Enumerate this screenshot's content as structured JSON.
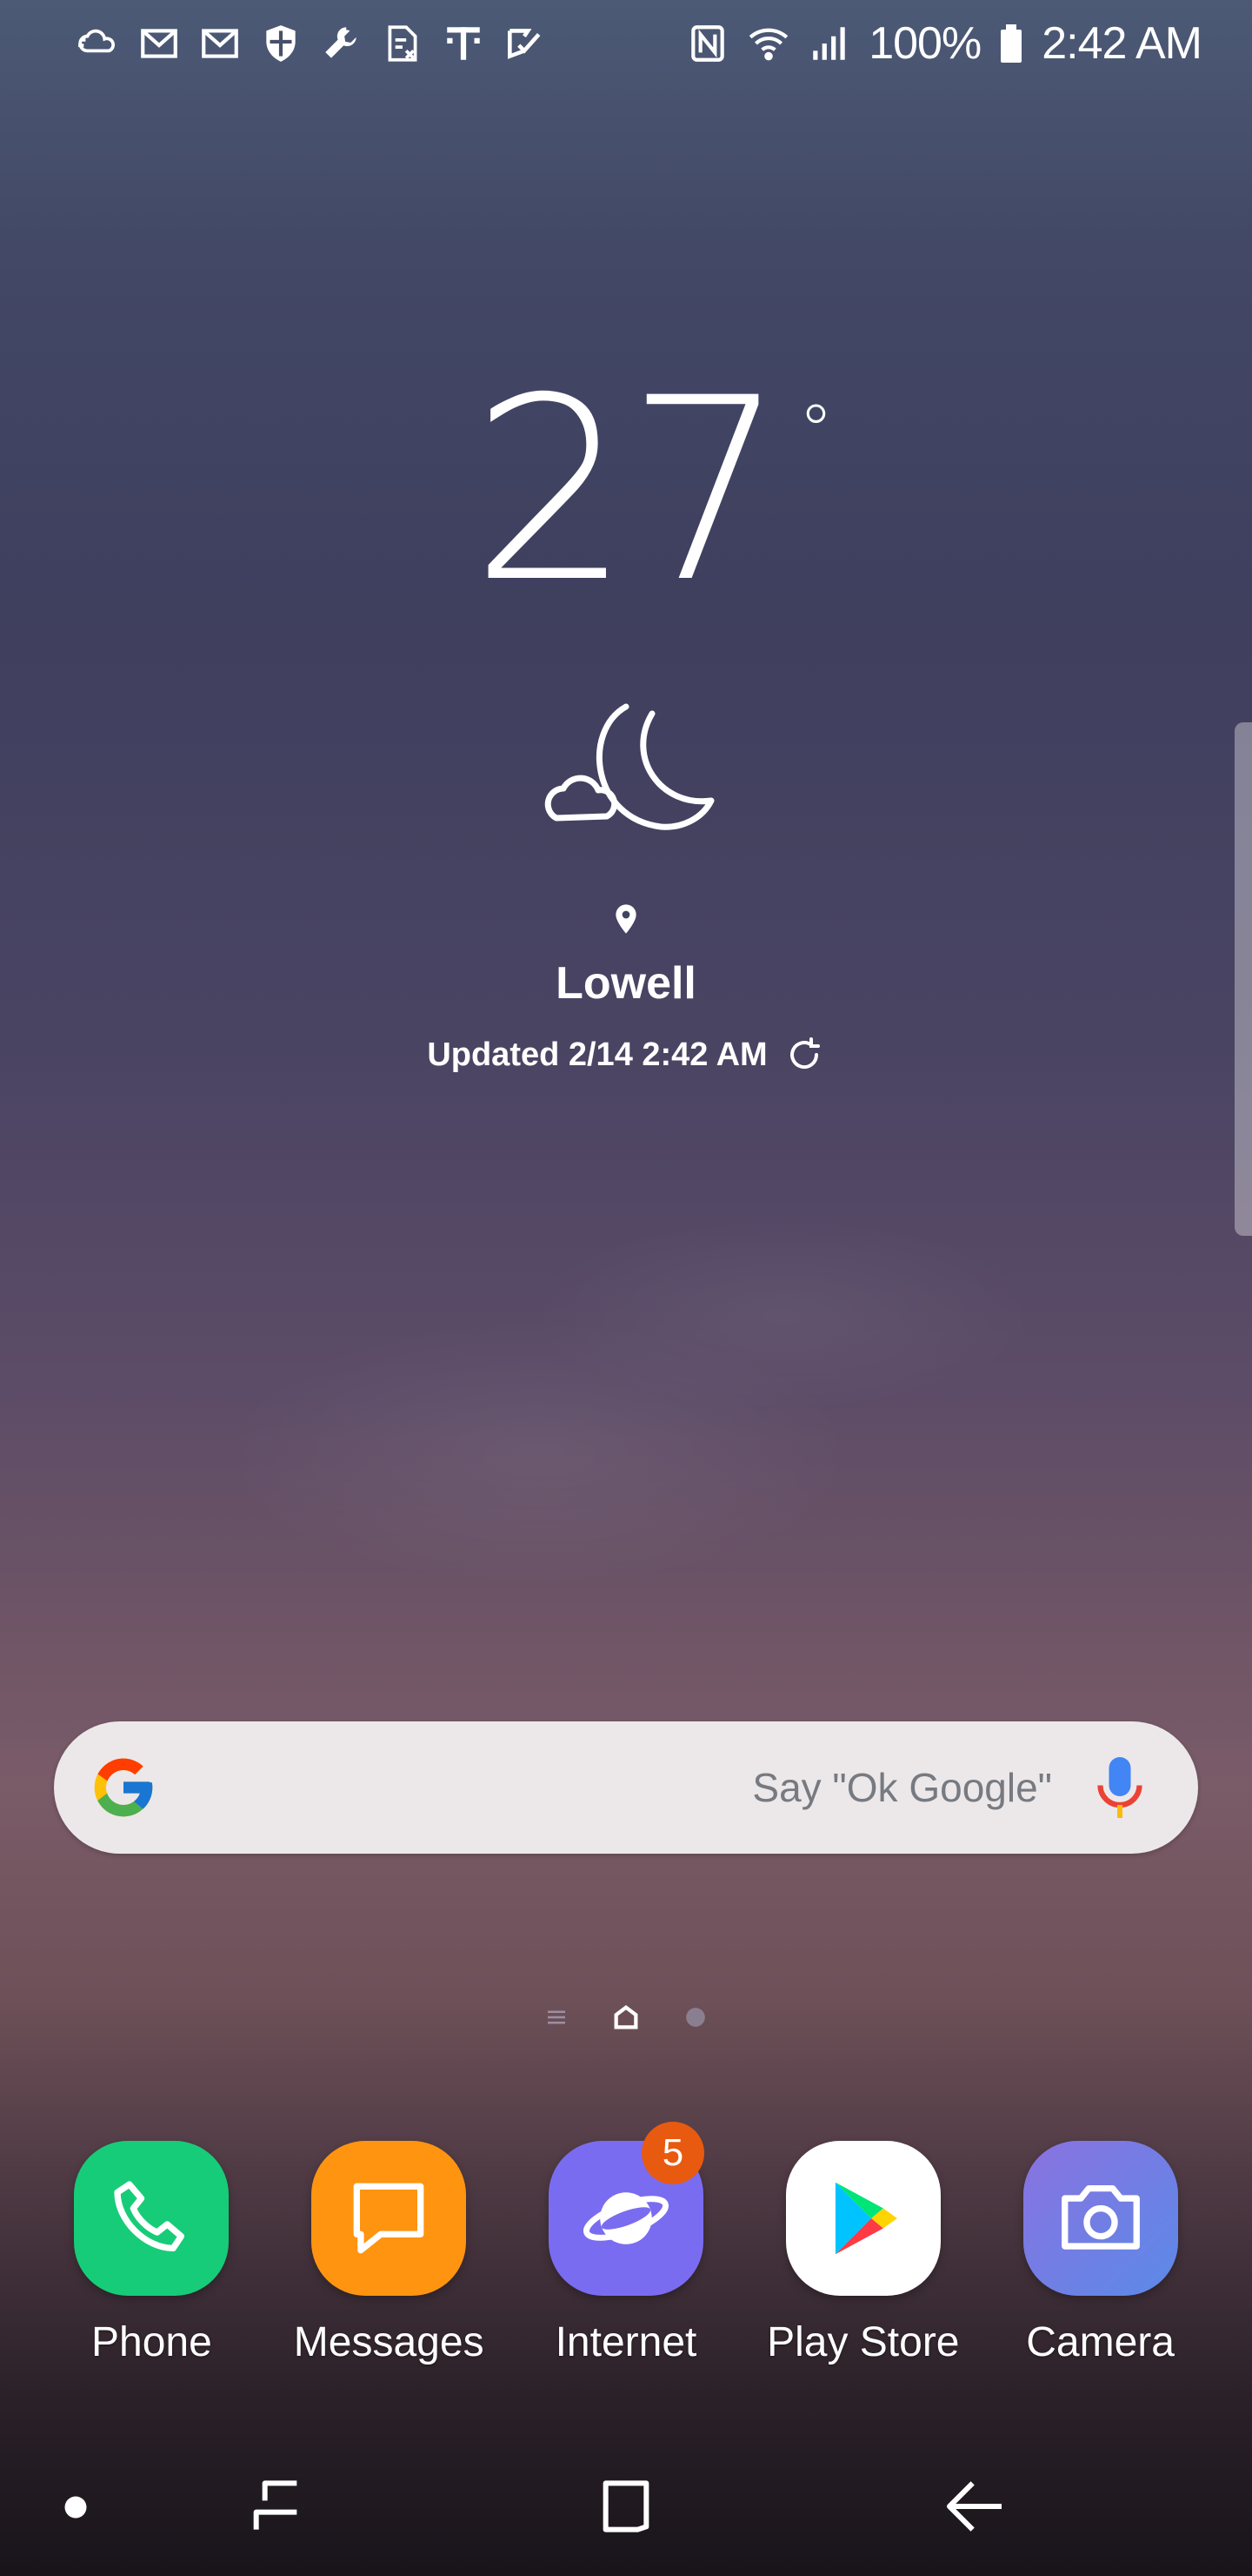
{
  "status_bar": {
    "left_icons": [
      "cloud-sync-icon",
      "gmail-icon",
      "gmail-icon",
      "shield-icon",
      "wrench-icon",
      "sim-icon",
      "tmobile-icon",
      "check-icon"
    ],
    "right_icons": [
      "nfc-icon",
      "wifi-icon",
      "signal-icon"
    ],
    "battery": "100%",
    "time": "2:42 AM"
  },
  "weather": {
    "temperature": "27",
    "degree_symbol": "°",
    "condition_icon": "cloudy-night-icon",
    "city": "Lowell",
    "updated": "Updated 2/14 2:42 AM"
  },
  "search": {
    "hint": "Say \"Ok Google\""
  },
  "page_indicator": {
    "pages": [
      "list",
      "home",
      "dot"
    ],
    "current": "home"
  },
  "dock": {
    "apps": [
      {
        "label": "Phone",
        "icon": "phone-icon",
        "color": "#17cc78"
      },
      {
        "label": "Messages",
        "icon": "messages-icon",
        "color": "#ff9410"
      },
      {
        "label": "Internet",
        "icon": "planet-icon",
        "color": "#7a6cf0",
        "badge": "5"
      },
      {
        "label": "Play Store",
        "icon": "play-store-icon",
        "color": "#ffffff"
      },
      {
        "label": "Camera",
        "icon": "camera-icon",
        "color": "#7a84e8"
      }
    ]
  },
  "nav_bar": {
    "buttons": [
      "dot-icon",
      "recents-icon",
      "home-icon",
      "back-icon"
    ]
  }
}
